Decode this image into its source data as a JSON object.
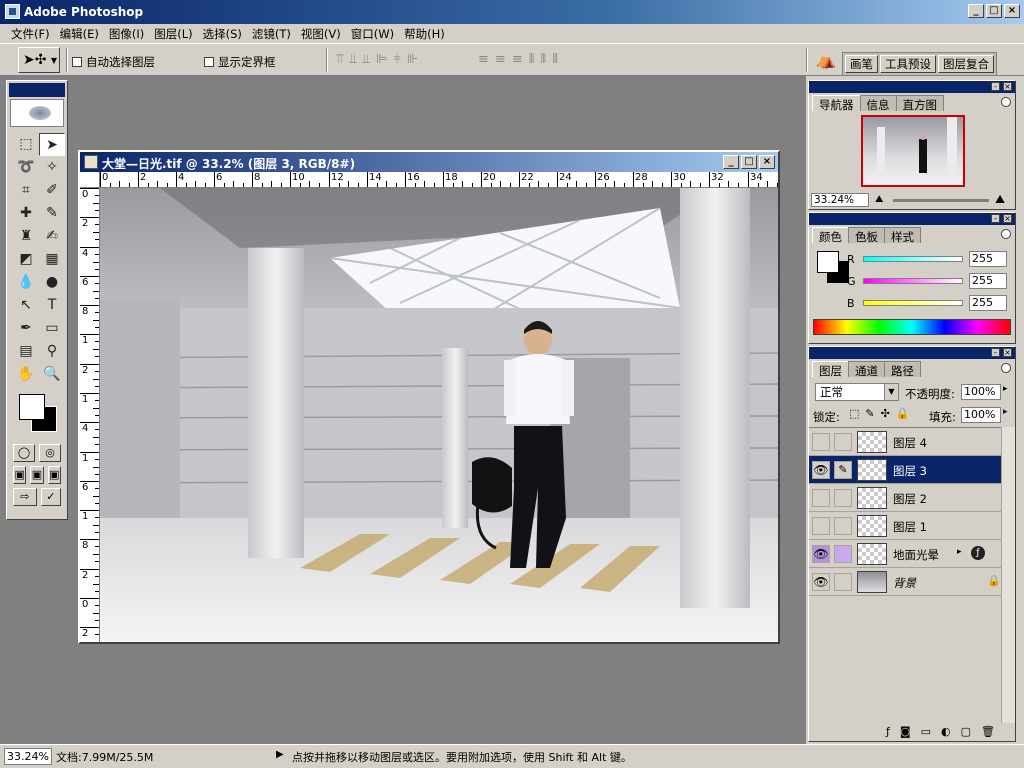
{
  "app": {
    "title": "Adobe Photoshop"
  },
  "window_controls": {
    "minimize": "_",
    "maximize": "□",
    "close": "×"
  },
  "menu": [
    "文件(F)",
    "编辑(E)",
    "图像(I)",
    "图层(L)",
    "选择(S)",
    "滤镜(T)",
    "视图(V)",
    "窗口(W)",
    "帮助(H)"
  ],
  "options_bar": {
    "auto_select_layer": "自动选择图层",
    "show_bounding_box": "显示定界框",
    "palette_well": [
      "画笔",
      "工具预设",
      "图层复合"
    ]
  },
  "document": {
    "title": "大堂—日光.tif @ 33.2% (图层 3, RGB/8#)",
    "ruler_h": [
      "0",
      "2",
      "4",
      "6",
      "8",
      "10",
      "12",
      "14",
      "16",
      "18",
      "20",
      "22",
      "24",
      "26",
      "28",
      "30",
      "32",
      "34"
    ],
    "ruler_v": [
      "0",
      "2",
      "4",
      "6",
      "8",
      "1",
      "2",
      "1",
      "4",
      "1",
      "6",
      "1",
      "8",
      "2",
      "0",
      "2"
    ]
  },
  "navigator": {
    "tabs": [
      "导航器",
      "信息",
      "直方图"
    ],
    "zoom": "33.24%"
  },
  "color_panel": {
    "tabs": [
      "颜色",
      "色板",
      "样式"
    ],
    "channels": [
      {
        "label": "R",
        "value": "255",
        "color": "#00ffff"
      },
      {
        "label": "G",
        "value": "255",
        "color": "#ff00ff"
      },
      {
        "label": "B",
        "value": "255",
        "color": "#ffff00"
      }
    ]
  },
  "layers_panel": {
    "tabs": [
      "图层",
      "通道",
      "路径"
    ],
    "blend_mode": "正常",
    "opacity_label": "不透明度:",
    "opacity_value": "100%",
    "lock_label": "锁定:",
    "fill_label": "填充:",
    "fill_value": "100%",
    "layers": [
      {
        "name": "图层 4",
        "visible": false,
        "selected": false
      },
      {
        "name": "图层 3",
        "visible": true,
        "selected": true
      },
      {
        "name": "图层 2",
        "visible": false,
        "selected": false
      },
      {
        "name": "图层 1",
        "visible": false,
        "selected": false
      },
      {
        "name": "地面光晕",
        "visible": true,
        "selected": false
      },
      {
        "name": "背景",
        "visible": true,
        "selected": false
      }
    ]
  },
  "status_bar": {
    "zoom": "33.24%",
    "doc_size": "文档:7.99M/25.5M",
    "hint": "点按并拖移以移动图层或选区。要用附加选项，使用 Shift 和 Alt 键。"
  }
}
